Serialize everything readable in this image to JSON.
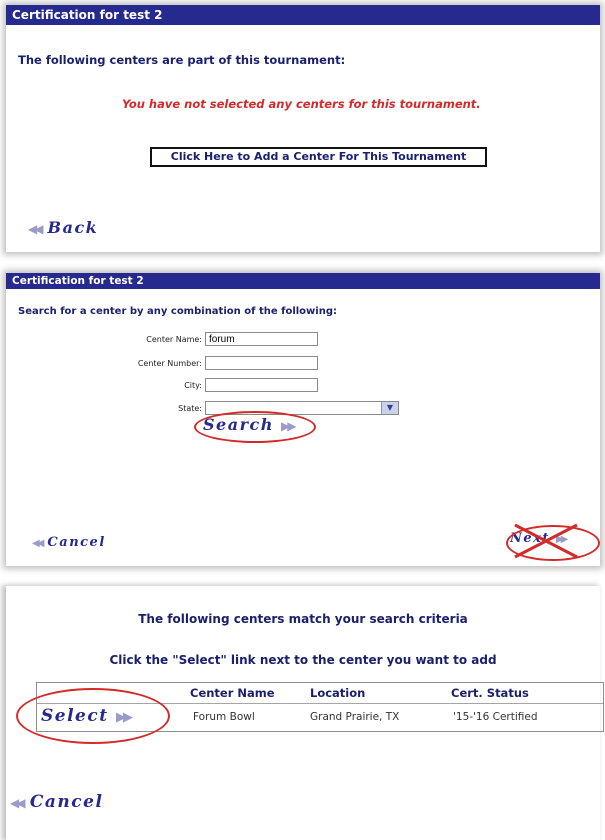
{
  "panel1": {
    "title": "Certification for test 2",
    "heading": "The following centers are part of this tournament:",
    "notice": "You have not selected any centers for this tournament.",
    "add_button": "Click Here to Add a Center For This Tournament",
    "back_label": "Back"
  },
  "panel2": {
    "title": "Certification for test 2",
    "heading": "Search for a center by any combination of the following:",
    "fields": {
      "center_name_label": "Center Name:",
      "center_name_value": "forum",
      "center_number_label": "Center Number:",
      "center_number_value": "",
      "city_label": "City:",
      "city_value": "",
      "state_label": "State:",
      "state_value": ""
    },
    "search_label": "Search",
    "cancel_label": "Cancel",
    "next_label": "Next"
  },
  "panel3": {
    "line1": "The following centers match your search criteria",
    "line2": "Click the \"Select\" link next to the center you want to add",
    "columns": [
      "Center Name",
      "Location",
      "Cert. Status"
    ],
    "rows": [
      {
        "select_label": "Select",
        "center_name": "Forum Bowl",
        "location": "Grand Prairie, TX",
        "cert_status": "'15-'16 Certified"
      }
    ],
    "cancel_label": "Cancel"
  },
  "colors": {
    "titlebar": "#262a8f",
    "link": "#262a8f",
    "notice": "#d32a2a",
    "annotation": "#d32a2a"
  }
}
